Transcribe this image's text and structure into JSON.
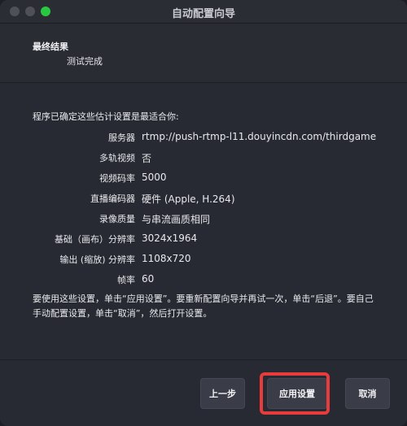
{
  "window": {
    "title": "自动配置向导",
    "close_color": "#4f5058",
    "minimize_color": "#4f5058",
    "zoom_color": "#2ac840"
  },
  "header": {
    "heading": "最终结果",
    "subheading": "测试完成"
  },
  "content": {
    "intro": "程序已确定这些估计设置是最适合你:",
    "rows": [
      {
        "label": "服务器",
        "value": "rtmp://push-rtmp-l11.douyincdn.com/thirdgame"
      },
      {
        "label": "多轨视频",
        "value": "否"
      },
      {
        "label": "视频码率",
        "value": "5000"
      },
      {
        "label": "直播编码器",
        "value": "硬件 (Apple, H.264)"
      },
      {
        "label": "录像质量",
        "value": "与串流画质相同"
      },
      {
        "label": "基础（画布）分辨率",
        "value": "3024x1964"
      },
      {
        "label": "输出 (缩放) 分辨率",
        "value": "1108x720"
      },
      {
        "label": "帧率",
        "value": "60"
      }
    ],
    "note": "要使用这些设置，单击“应用设置”。要重新配置向导并再试一次，单击“后退”。要自己手动配置设置，单击“取消”，然后打开设置。"
  },
  "footer": {
    "back_label": "上一步",
    "apply_label": "应用设置",
    "cancel_label": "取消",
    "highlight_color": "#e83b3b"
  }
}
